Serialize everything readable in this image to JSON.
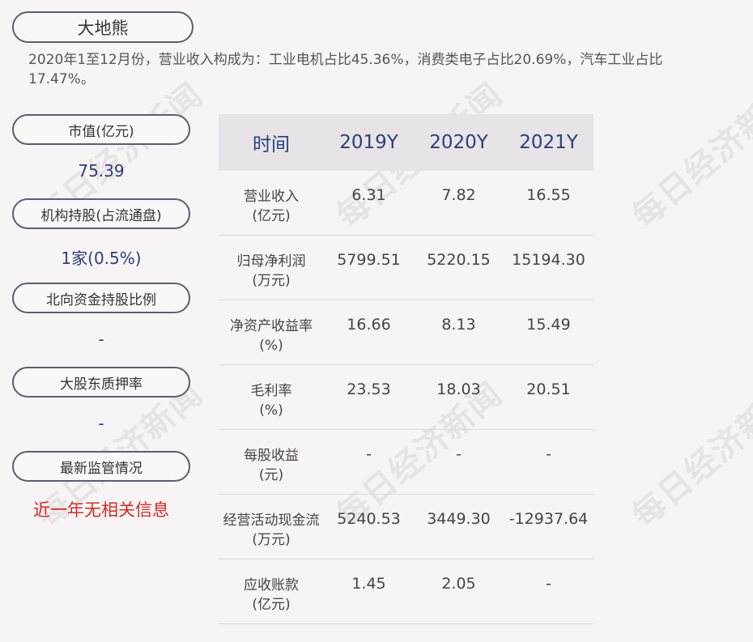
{
  "company": "大地熊",
  "summary": "2020年1至12月份，营业收入构成为：工业电机占比45.36%，消费类电子占比20.69%，汽车工业占比17.47%。",
  "sidebar": [
    {
      "label": "市值(亿元)",
      "value": "75.39"
    },
    {
      "label": "机构持股(占流通盘)",
      "value": "1家(0.5%)"
    },
    {
      "label": "北向资金持股比例",
      "value": "-"
    },
    {
      "label": "大股东质押率",
      "value": "-"
    },
    {
      "label": "最新监管情况",
      "value": "近一年无相关信息"
    }
  ],
  "table": {
    "headers": [
      "时间",
      "2019Y",
      "2020Y",
      "2021Y"
    ],
    "rows": [
      {
        "label": "营业收入",
        "unit": "(亿元)",
        "values": [
          "6.31",
          "7.82",
          "16.55"
        ]
      },
      {
        "label": "归母净利润",
        "unit": "(万元)",
        "values": [
          "5799.51",
          "5220.15",
          "15194.30"
        ]
      },
      {
        "label": "净资产收益率",
        "unit": "(%)",
        "values": [
          "16.66",
          "8.13",
          "15.49"
        ]
      },
      {
        "label": "毛利率",
        "unit": "(%)",
        "values": [
          "23.53",
          "18.03",
          "20.51"
        ]
      },
      {
        "label": "每股收益",
        "unit": "(元)",
        "values": [
          "-",
          "-",
          "-"
        ]
      },
      {
        "label": "经营活动现金流",
        "unit": "(万元)",
        "values": [
          "5240.53",
          "3449.30",
          "-12937.64"
        ]
      },
      {
        "label": "应收账款",
        "unit": "(亿元)",
        "values": [
          "1.45",
          "2.05",
          "-"
        ]
      }
    ]
  },
  "watermark": "每日经济新闻",
  "colors": {
    "accent": "#2c3f78",
    "alert": "#d42a2a",
    "header_bg": "#e7e3e6",
    "page_bg": "#f8f4f5"
  }
}
